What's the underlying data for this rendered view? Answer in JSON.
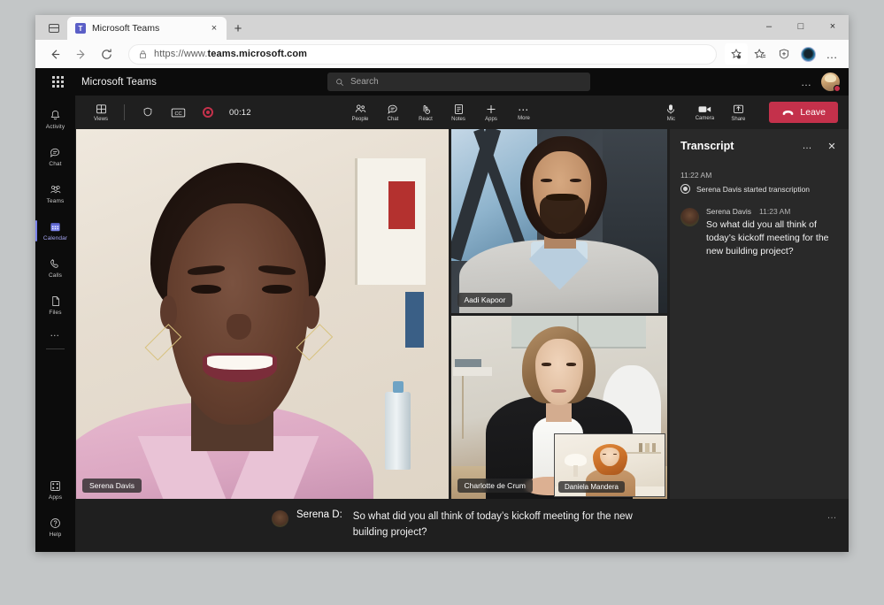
{
  "browser": {
    "tab": {
      "title": "Microsoft Teams",
      "favicon": "teams-icon",
      "close": "×"
    },
    "new_tab": "+",
    "window_controls": {
      "minimize": "–",
      "maximize": "□",
      "close": "×"
    },
    "nav": {
      "back": "back-arrow",
      "forward": "forward-arrow",
      "reload": "reload-arrow"
    },
    "address": {
      "lock": "lock-icon",
      "url_prefix": "https://www.",
      "url_domain": "teams.microsoft.com",
      "full_url": "https://www.teams.microsoft.com"
    },
    "toolbar_icons": [
      "collections-star-icon",
      "favorites-star-icon",
      "browser-essentials-icon",
      "profile-avatar",
      "settings-more-icon"
    ],
    "more": "…"
  },
  "teams": {
    "brand": "Microsoft Teams",
    "waffle": "app-launcher-icon",
    "search": {
      "placeholder": "Search",
      "icon": "search-icon"
    },
    "topbar_more": "…",
    "rail": [
      {
        "label": "Activity",
        "icon": "bell-icon",
        "active": false
      },
      {
        "label": "Chat",
        "icon": "chat-bubble-icon",
        "active": false
      },
      {
        "label": "Teams",
        "icon": "teams-people-icon",
        "active": false
      },
      {
        "label": "Calendar",
        "icon": "calendar-icon",
        "active": true
      },
      {
        "label": "Calls",
        "icon": "phone-icon",
        "active": false
      },
      {
        "label": "Files",
        "icon": "file-icon",
        "active": false
      }
    ],
    "rail_more": "…",
    "rail_bottom": [
      {
        "label": "Apps",
        "icon": "apps-grid-icon"
      },
      {
        "label": "Help",
        "icon": "help-question-icon"
      }
    ]
  },
  "meeting": {
    "controls_left": [
      {
        "label": "Views",
        "icon": "views-grid-icon"
      }
    ],
    "status_icons": [
      {
        "name": "shield-icon",
        "label": ""
      },
      {
        "name": "closed-caption-icon",
        "label": "CC"
      }
    ],
    "recording": {
      "icon": "record-dot-icon",
      "timer": "00:12"
    },
    "controls_center": [
      {
        "label": "People",
        "icon": "people-icon"
      },
      {
        "label": "Chat",
        "icon": "chat-icon"
      },
      {
        "label": "React",
        "icon": "react-hand-icon"
      },
      {
        "label": "Notes",
        "icon": "notes-icon"
      },
      {
        "label": "Apps",
        "icon": "plus-apps-icon"
      },
      {
        "label": "More",
        "icon": "more-dots-icon"
      }
    ],
    "controls_right": [
      {
        "label": "Mic",
        "icon": "microphone-icon"
      },
      {
        "label": "Camera",
        "icon": "camera-icon"
      },
      {
        "label": "Share",
        "icon": "share-screen-icon"
      }
    ],
    "leave": {
      "label": "Leave",
      "icon": "hangup-phone-icon",
      "color": "#c4314b"
    },
    "participants": [
      {
        "name": "Serena Davis",
        "position": "main"
      },
      {
        "name": "Aadi Kapoor",
        "position": "side-top"
      },
      {
        "name": "Charlotte de Crum",
        "position": "side-bottom"
      },
      {
        "name": "Daniela Mandera",
        "position": "pip"
      }
    ],
    "caption": {
      "speaker": "Serena D:",
      "text": "So what did you all think of today’s kickoff meeting for the new building project?",
      "more": "…"
    }
  },
  "transcript": {
    "title": "Transcript",
    "more": "…",
    "close": "✕",
    "start_time": "11:22 AM",
    "system_message": "Serena Davis started transcription",
    "entries": [
      {
        "name": "Serena Davis",
        "time": "11:23 AM",
        "text": "So what did you all think of today’s kickoff meeting for the new building project?"
      }
    ]
  }
}
